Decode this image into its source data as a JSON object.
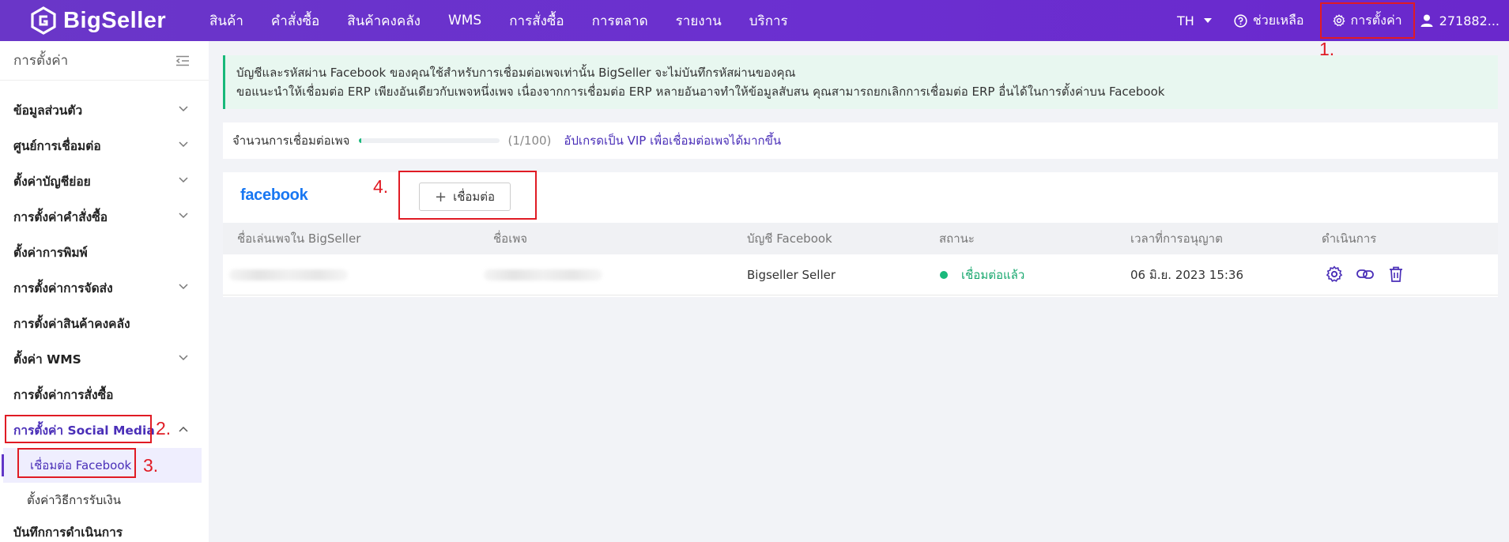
{
  "brand": {
    "name": "BigSeller"
  },
  "topnav": {
    "items": [
      "สินค้า",
      "คำสั่งซื้อ",
      "สินค้าคงคลัง",
      "WMS",
      "การสั่งซื้อ",
      "การตลาด",
      "รายงาน",
      "บริการ"
    ],
    "language": "TH",
    "help_label": "ช่วยเหลือ",
    "settings_label": "การตั้งค่า",
    "user_label": "271882..."
  },
  "sidebar": {
    "title": "การตั้งค่า",
    "items": [
      "ข้อมูลส่วนตัว",
      "ศูนย์การเชื่อมต่อ",
      "ตั้งค่าบัญชีย่อย",
      "การตั้งค่าคำสั่งซื้อ",
      "ตั้งค่าการพิมพ์",
      "การตั้งค่าการจัดส่ง",
      "การตั้งค่าสินค้าคงคลัง",
      "ตั้งค่า WMS",
      "การตั้งค่าการสั่งซื้อ",
      "การตั้งค่า Social Media",
      "บันทึกการดำเนินการ"
    ],
    "sub_items": [
      "เชื่อมต่อ Facebook",
      "ตั้งค่าวิธีการรับเงิน"
    ]
  },
  "annotations": {
    "s1": "1.",
    "s2": "2.",
    "s3": "3.",
    "s4": "4."
  },
  "notice": {
    "line1": "บัญชีและรหัสผ่าน Facebook ของคุณใช้สำหรับการเชื่อมต่อเพจเท่านั้น BigSeller จะไม่บันทึกรหัสผ่านของคุณ",
    "line2": "ขอแนะนำให้เชื่อมต่อ ERP เพียงอันเดียวกับเพจหนึ่งเพจ เนื่องจากการเชื่อมต่อ ERP หลายอันอาจทำให้ข้อมูลสับสน คุณสามารถยกเลิกการเชื่อมต่อ ERP อื่นได้ในการตั้งค่าบน Facebook"
  },
  "quota": {
    "label": "จำนวนการเชื่อมต่อเพจ",
    "count": "(1/100)",
    "progress": 0.01,
    "upgrade": "อัปเกรดเป็น VIP เพื่อเชื่อมต่อเพจได้มากขึ้น"
  },
  "facebook_panel": {
    "logo_text": "facebook",
    "connect_label": "เชื่อมต่อ",
    "columns": [
      "ชื่อเล่นเพจใน BigSeller",
      "ชื่อเพจ",
      "บัญชี Facebook",
      "สถานะ",
      "เวลาที่การอนุญาต",
      "ดำเนินการ"
    ],
    "rows": [
      {
        "account": "Bigseller Seller",
        "status": "เชื่อมต่อแล้ว",
        "authorized_at": "06 มิ.ย. 2023 15:36"
      }
    ]
  },
  "colors": {
    "accent": "#6a36c8",
    "success": "#19b97b",
    "annotation": "#e01b24",
    "facebook": "#1877f2"
  }
}
